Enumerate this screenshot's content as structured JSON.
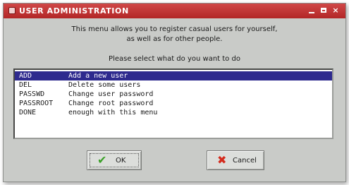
{
  "window": {
    "title": "USER ADMINISTRATION",
    "controls": {
      "minimize_icon": "minimize-icon",
      "maximize_icon": "maximize-icon",
      "close_label": "×"
    },
    "accent_color": "#b22626"
  },
  "message": {
    "line1": "This menu allows you to register casual users for yourself,",
    "line2": "as well as for other people.",
    "prompt": "Please select what do you want to do"
  },
  "menu": {
    "selected_index": 0,
    "items": [
      {
        "command": "ADD",
        "description": "Add a new user"
      },
      {
        "command": "DEL",
        "description": "Delete some users"
      },
      {
        "command": "PASSWD",
        "description": "Change user password"
      },
      {
        "command": "PASSROOT",
        "description": "Change root password"
      },
      {
        "command": "DONE",
        "description": "enough with this menu"
      }
    ]
  },
  "buttons": {
    "ok": {
      "label": "OK",
      "icon": "checkmark-icon",
      "glyph": "✔"
    },
    "cancel": {
      "label": "Cancel",
      "icon": "x-cancel-icon",
      "glyph": "✖"
    }
  }
}
